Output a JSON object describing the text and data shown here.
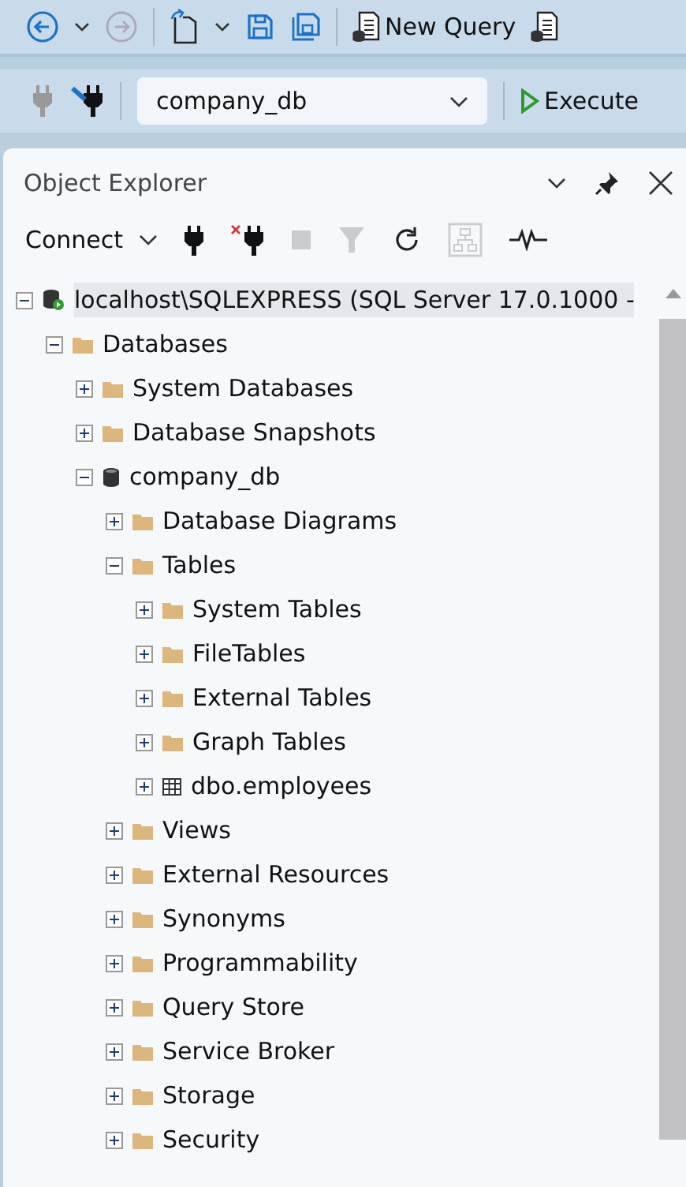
{
  "toolbar": {
    "new_query": "New Query"
  },
  "query_toolbar": {
    "database": "company_db",
    "execute": "Execute"
  },
  "object_explorer": {
    "title": "Object Explorer",
    "connect": "Connect"
  },
  "tree": [
    {
      "label": "localhost\\SQLEXPRESS (SQL Server 17.0.1000 -",
      "kind": "server",
      "expanded": true,
      "selected": true,
      "children": [
        {
          "label": "Databases",
          "kind": "folder",
          "expanded": true,
          "selected": false,
          "children": [
            {
              "label": "System Databases",
              "kind": "folder",
              "expanded": false,
              "selected": false
            },
            {
              "label": "Database Snapshots",
              "kind": "folder",
              "expanded": false,
              "selected": false
            },
            {
              "label": "company_db",
              "kind": "database",
              "expanded": true,
              "selected": false,
              "children": [
                {
                  "label": "Database Diagrams",
                  "kind": "folder",
                  "expanded": false,
                  "selected": false
                },
                {
                  "label": "Tables",
                  "kind": "folder",
                  "expanded": true,
                  "selected": false,
                  "children": [
                    {
                      "label": "System Tables",
                      "kind": "folder",
                      "expanded": false,
                      "selected": false
                    },
                    {
                      "label": "FileTables",
                      "kind": "folder",
                      "expanded": false,
                      "selected": false
                    },
                    {
                      "label": "External Tables",
                      "kind": "folder",
                      "expanded": false,
                      "selected": false
                    },
                    {
                      "label": "Graph Tables",
                      "kind": "folder",
                      "expanded": false,
                      "selected": false
                    },
                    {
                      "label": "dbo.employees",
                      "kind": "table",
                      "expanded": false,
                      "selected": false
                    }
                  ]
                },
                {
                  "label": "Views",
                  "kind": "folder",
                  "expanded": false,
                  "selected": false
                },
                {
                  "label": "External Resources",
                  "kind": "folder",
                  "expanded": false,
                  "selected": false
                },
                {
                  "label": "Synonyms",
                  "kind": "folder",
                  "expanded": false,
                  "selected": false
                },
                {
                  "label": "Programmability",
                  "kind": "folder",
                  "expanded": false,
                  "selected": false
                },
                {
                  "label": "Query Store",
                  "kind": "folder",
                  "expanded": false,
                  "selected": false
                },
                {
                  "label": "Service Broker",
                  "kind": "folder",
                  "expanded": false,
                  "selected": false
                },
                {
                  "label": "Storage",
                  "kind": "folder",
                  "expanded": false,
                  "selected": false
                },
                {
                  "label": "Security",
                  "kind": "folder",
                  "expanded": false,
                  "selected": false
                }
              ]
            }
          ]
        }
      ]
    }
  ]
}
